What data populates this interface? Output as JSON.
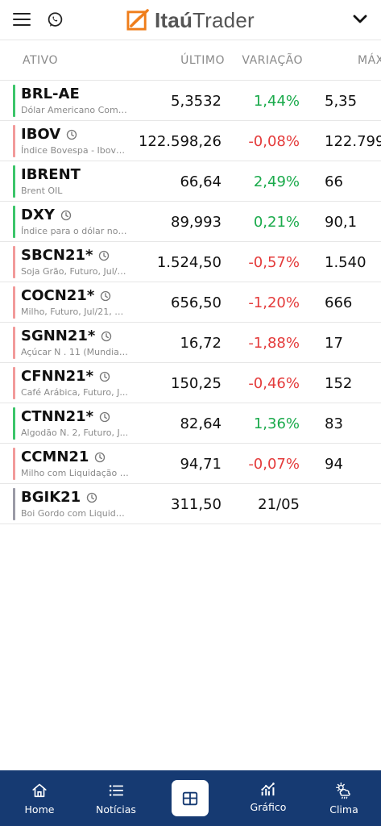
{
  "header": {
    "logo_bold": "Itaú",
    "logo_light": "Trader"
  },
  "columns": {
    "ativo": "ATIVO",
    "ultimo": "ÚLTIMO",
    "variacao": "VARIAÇÃO",
    "max": "MÁX"
  },
  "rows": [
    {
      "symbol": "BRL-AE",
      "desc": "Dólar Americano Come...",
      "last": "5,3532",
      "var": "1,44%",
      "max": "5,35",
      "trend": "pos",
      "clock": false
    },
    {
      "symbol": "IBOV",
      "desc": "Índice Bovespa - Iboves...",
      "last": "122.598,26",
      "var": "-0,08%",
      "max": "122.799",
      "trend": "neg",
      "clock": true
    },
    {
      "symbol": "IBRENT",
      "desc": "Brent OIL",
      "last": "66,64",
      "var": "2,49%",
      "max": "66",
      "trend": "pos",
      "clock": false
    },
    {
      "symbol": "DXY",
      "desc": "Índice para o dólar nor...",
      "last": "89,993",
      "var": "0,21%",
      "max": "90,1",
      "trend": "pos",
      "clock": true
    },
    {
      "symbol": "SBCN21*",
      "desc": "Soja Grão, Futuro, Jul/2...",
      "last": "1.524,50",
      "var": "-0,57%",
      "max": "1.540",
      "trend": "neg",
      "clock": true
    },
    {
      "symbol": "COCN21*",
      "desc": "Milho, Futuro, Jul/21, El...",
      "last": "656,50",
      "var": "-1,20%",
      "max": "666",
      "trend": "neg",
      "clock": true
    },
    {
      "symbol": "SGNN21*",
      "desc": "Açúcar N . 11 (Mundial)...",
      "last": "16,72",
      "var": "-1,88%",
      "max": "17",
      "trend": "neg",
      "clock": true
    },
    {
      "symbol": "CFNN21*",
      "desc": "Café Arábica, Futuro, J...",
      "last": "150,25",
      "var": "-0,46%",
      "max": "152",
      "trend": "neg",
      "clock": true
    },
    {
      "symbol": "CTNN21*",
      "desc": "Algodão N. 2, Futuro, J...",
      "last": "82,64",
      "var": "1,36%",
      "max": "83",
      "trend": "pos",
      "clock": true
    },
    {
      "symbol": "CCMN21",
      "desc": "Milho com Liquidação F...",
      "last": "94,71",
      "var": "-0,07%",
      "max": "94",
      "trend": "neg",
      "clock": true
    },
    {
      "symbol": "BGIK21",
      "desc": "Boi Gordo com Liquida...",
      "last": "311,50",
      "var": "21/05",
      "max": "",
      "trend": "neutral",
      "clock": true
    }
  ],
  "colors": {
    "pos": "#1aaa4b",
    "neg": "#e43b3b",
    "bar_pos": "#3cc56a",
    "bar_neg": "#f29a9a",
    "bar_neutral": "#9a9aa6",
    "nav_bg": "#163a72",
    "logo_orange": "#ef7d1a"
  },
  "nav": {
    "home": "Home",
    "noticias": "Notícias",
    "grafico": "Gráfico",
    "clima": "Clima"
  },
  "icons": {
    "menu": "menu-icon",
    "whatsapp": "whatsapp-icon",
    "chevron": "chevron-down-icon",
    "clock": "clock-icon",
    "home": "home-icon",
    "news": "list-icon",
    "quotes": "grid-icon",
    "chart": "chart-icon",
    "weather": "weather-icon"
  }
}
